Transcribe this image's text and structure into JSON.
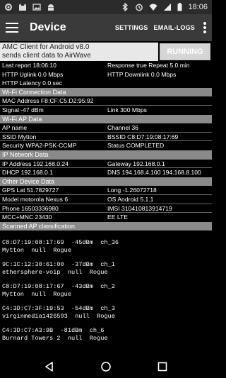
{
  "status_bar": {
    "left_icons": [
      "settings-icon",
      "cat-icon",
      "image-icon",
      "android-icon"
    ],
    "right_icons": [
      "bluetooth-icon",
      "alarm-icon",
      "wifi-icon",
      "signal-icon",
      "battery-icon"
    ],
    "time": "18:06"
  },
  "appbar": {
    "title": "Device",
    "settings_label": "SETTINGS",
    "email_logs_label": "EMAIL-LOGS"
  },
  "notice": {
    "line1": "AMC Client for Android v8.0",
    "line2": "sends client data to AirWave",
    "button_label": "RUNNING"
  },
  "rows_top": [
    {
      "c1": "Last report 18:06:10",
      "c2": "Response true   Repeat 5.0 min"
    },
    {
      "c1": "HTTP Uplink  0.0  Mbps",
      "c2": "HTTP Downlink  0.0  Mbps"
    },
    {
      "c1": "HTTP Latency 0.0  sec",
      "c2": ""
    }
  ],
  "sections": {
    "wifi_connection": "Wi-Fi Connection Data",
    "wifi_ap": "Wi-Fi AP Data",
    "ip_network": "IP Network Data",
    "other_device": "Other Device Data",
    "scanned_ap": "Scanned AP classification"
  },
  "wifi_connection_rows": [
    {
      "c1": "MAC Address  F8:CF:C5:D2:95:92",
      "c2": ""
    },
    {
      "c1": "Signal  -47 dBm",
      "c2": "Link  300 Mbps"
    }
  ],
  "wifi_ap_rows": [
    {
      "c1": "AP name",
      "c2": "Channel  36"
    },
    {
      "c1": "SSID  Mytton",
      "c2": "BSSID  C8:D7:19:08:17:69"
    },
    {
      "c1": "Security  WPA2-PSK-CCMP",
      "c2": "Status COMPLETED"
    }
  ],
  "ip_rows": [
    {
      "c1": "IP Address  192.168.0.24",
      "c2": "Gateway  192.168.0.1"
    },
    {
      "c1": "DHCP  192.168.0.1",
      "c2": "DNS 194.168.4.100  194.168.8.100"
    }
  ],
  "other_rows": [
    {
      "c1": "GPS Lat  51.7829727",
      "c2": "Long  -1.26072718"
    },
    {
      "c1": "Model  motorola  Nexus 6",
      "c2": "OS  Android 5.1.1"
    },
    {
      "c1": "Phone 16503336980",
      "c2": "IMSI 310410813914719"
    },
    {
      "c1": "MCC+MNC 23430",
      "c2": "EE  LTE"
    }
  ],
  "scanned_aps": [
    {
      "l1": "C8:D7:19:08:17:69  -45dBm  ch_36",
      "l2": "Mytton  null  Rogue"
    },
    {
      "l1": "9C:1C:12:30:61:00  -37dBm  ch_1",
      "l2": "ethersphere-voip  null  Rogue"
    },
    {
      "l1": "C8:D7:19:08:17:67  -43dBm  ch_2",
      "l2": "Mytton  null  Rogue"
    },
    {
      "l1": "C4:3D:C7:3F:19:53  -54dBm  ch_3",
      "l2": "virginmedia1426593  null  Rogue"
    },
    {
      "l1": "C4:3D:C7:A3:9B  -81dBm  ch_6",
      "l2": "Burnard Towers 2  null  Rogue"
    }
  ],
  "navbar": {
    "icons": [
      "back-icon",
      "home-icon",
      "recents-icon"
    ]
  },
  "colors": {
    "appbar": "#3a3a3a",
    "section_header": "#8a8a8a",
    "notice_bg": "#e8e8e8",
    "button_bg": "#d6d6d6"
  }
}
